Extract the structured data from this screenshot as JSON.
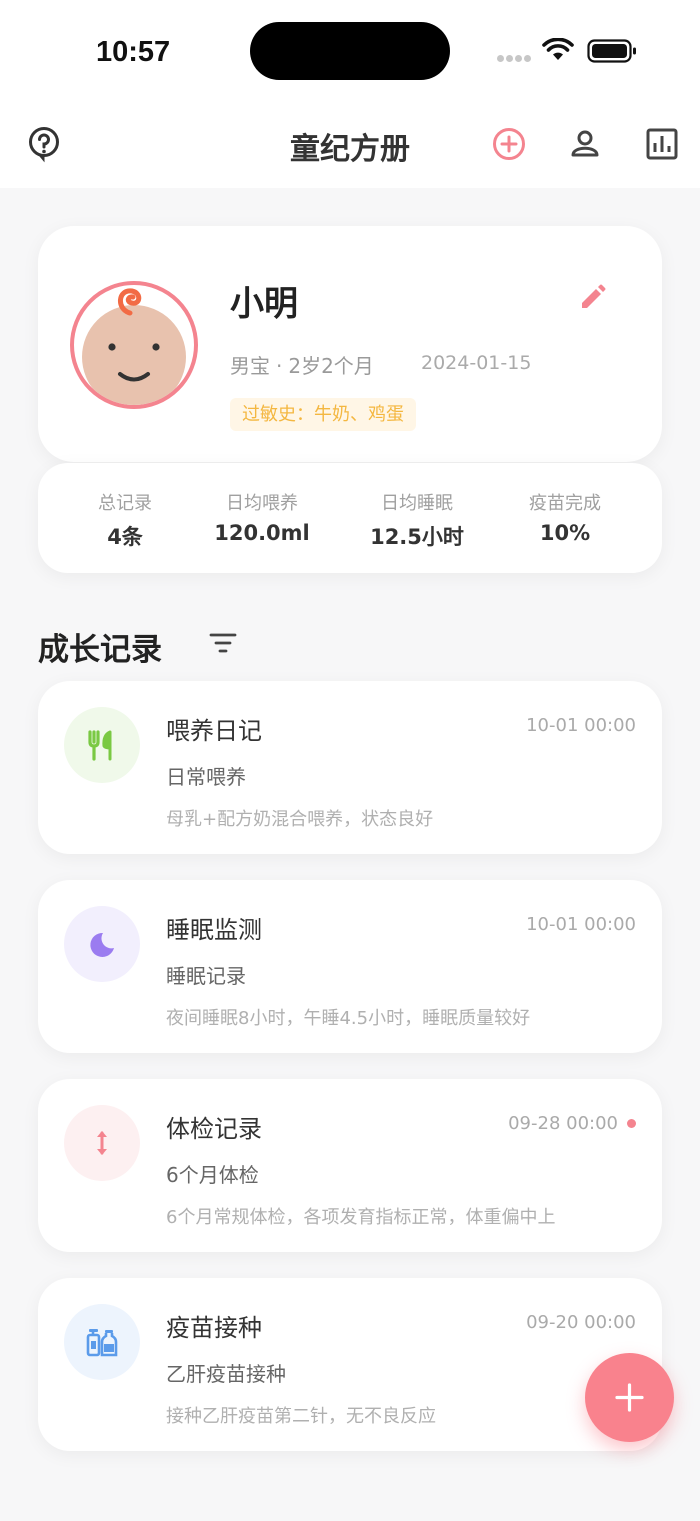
{
  "status_bar": {
    "time": "10:57"
  },
  "nav": {
    "title": "童纪方册",
    "icons": [
      "help-icon",
      "add-circle-icon",
      "person-icon",
      "stats-icon"
    ],
    "accent_color": "#f4848f"
  },
  "profile": {
    "name": "小明",
    "gender": "男宝",
    "age": "2岁2个月",
    "birth_date": "2024-01-15",
    "allergy": "过敏史：牛奶、鸡蛋"
  },
  "stats": [
    {
      "label": "总记录",
      "value": "4条"
    },
    {
      "label": "日均喂养",
      "value": "120.0ml"
    },
    {
      "label": "日均睡眠",
      "value": "12.5小时"
    },
    {
      "label": "疫苗完成",
      "value": "10%"
    }
  ],
  "section": {
    "title": "成长记录"
  },
  "records": [
    {
      "title": "喂养日记",
      "time": "10-01 00:00",
      "subtitle": "日常喂养",
      "desc": "母乳+配方奶混合喂养，状态良好",
      "icon": "utensils-icon",
      "color": "#7ac943",
      "bg": "#f0f9ea"
    },
    {
      "title": "睡眠监测",
      "time": "10-01 00:00",
      "subtitle": "睡眠记录",
      "desc": "夜间睡眠8小时，午睡4.5小时，睡眠质量较好",
      "icon": "moon-icon",
      "color": "#9b7cf0",
      "bg": "#f2effd"
    },
    {
      "title": "体检记录",
      "time": "09-28 00:00",
      "subtitle": "6个月体检",
      "desc": "6个月常规体检，各项发育指标正常，体重偏中上",
      "icon": "height-icon",
      "color": "#f4848f",
      "bg": "#fdf0f1"
    },
    {
      "title": "疫苗接种",
      "time": "09-20 00:00",
      "subtitle": "乙肝疫苗接种",
      "desc": "接种乙肝疫苗第二针，无不良反应",
      "icon": "vaccine-icon",
      "color": "#5b9bea",
      "bg": "#edf4fd"
    }
  ]
}
